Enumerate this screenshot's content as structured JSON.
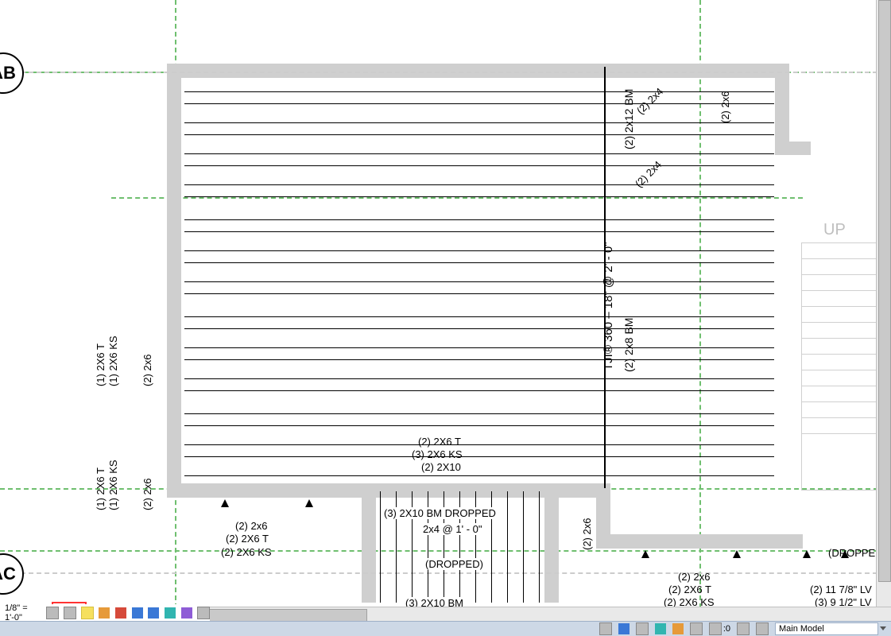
{
  "grid_bubbles": {
    "ab_label": "AB",
    "ac_label": "AC"
  },
  "annotations": {
    "up": "UP",
    "tji_main": "TJI® 360 – 18\" @ 2' - 0\"",
    "beam_2x12": "(2) 2x12 BM",
    "plate_2x4_a": "(2) 2x4",
    "plate_2x4_b": "(2) 2x4",
    "plate_2x6_top_right": "(2) 2x6",
    "beam_2x8": "(2) 2x8 BM",
    "left_group1_1": "(1) 2X6 T",
    "left_group1_2": "(1) 2X6 KS",
    "left_group1_3": "(2) 2x6",
    "left_group2_1": "(1) 2X6 T",
    "left_group2_2": "(1) 2X6 KS",
    "left_group2_3": "(2) 2x6",
    "mid_top_1": "(2) 2X6 T",
    "mid_top_2": "(3) 2X6 KS",
    "mid_top_3": "(2) 2X10",
    "bay_line1": "(3)  2X10 BM DROPPED",
    "bay_line2": "2x4  @  1' - 0\"",
    "bay_line3": "(DROPPED)",
    "bay_line4": "(3)   2X10 BM",
    "btm_left_1": "(2) 2x6",
    "btm_left_2": "(2) 2X6 T",
    "btm_left_3": "(2) 2X6 KS",
    "btm_mid_2x6_v": "(2) 2x6",
    "btm_right_1": "(2) 2x6",
    "btm_right_2": "(2) 2X6 T",
    "btm_right_3": "(2) 2X6 KS",
    "far_right_0": "(DROPPED",
    "far_right_1": "(2) 11 7/8\" LV",
    "far_right_2": "(3) 9 1/2\" LV"
  },
  "view_bar": {
    "scale": "1/8\" = 1'-0\"",
    "icons": {
      "i1": "graphic-display-options-icon",
      "i2": "thin-lines-icon",
      "i3": "show-hidden-icon",
      "i4": "sun-path-icon",
      "i5": "shadows-icon",
      "i6": "rendering-icon",
      "i7": "crop-view-icon",
      "i8": "crop-region-visible-icon",
      "i9": "lock-3d-icon",
      "i10": "temp-hide-icon",
      "i11": "reveal-constraints-icon"
    }
  },
  "status_bar": {
    "filter_count": ":0",
    "main_model": "Main Model",
    "icons": {
      "reveal": "editable-only-icon",
      "select_links": "select-links-icon",
      "select_underlay": "select-underlay-icon",
      "select_pinned": "select-pinned-icon",
      "select_face": "select-by-face-icon",
      "drag_elements": "drag-elements-icon",
      "filter": "filter-icon"
    }
  }
}
